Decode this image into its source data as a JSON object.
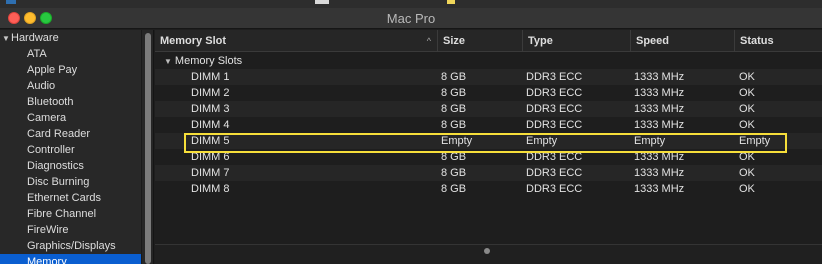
{
  "window": {
    "title": "Mac Pro"
  },
  "sidebar": {
    "groups": [
      {
        "label": "Hardware"
      }
    ],
    "items": [
      {
        "label": "ATA"
      },
      {
        "label": "Apple Pay"
      },
      {
        "label": "Audio"
      },
      {
        "label": "Bluetooth"
      },
      {
        "label": "Camera"
      },
      {
        "label": "Card Reader"
      },
      {
        "label": "Controller"
      },
      {
        "label": "Diagnostics"
      },
      {
        "label": "Disc Burning"
      },
      {
        "label": "Ethernet Cards"
      },
      {
        "label": "Fibre Channel"
      },
      {
        "label": "FireWire"
      },
      {
        "label": "Graphics/Displays"
      },
      {
        "label": "Memory",
        "selected": true
      }
    ]
  },
  "table": {
    "columns": [
      {
        "label": "Memory Slot",
        "sort_indicator": "^"
      },
      {
        "label": "Size"
      },
      {
        "label": "Type"
      },
      {
        "label": "Speed"
      },
      {
        "label": "Status"
      }
    ],
    "group_label": "Memory Slots",
    "rows": [
      {
        "slot": "DIMM 1",
        "size": "8 GB",
        "type": "DDR3 ECC",
        "speed": "1333 MHz",
        "status": "OK"
      },
      {
        "slot": "DIMM 2",
        "size": "8 GB",
        "type": "DDR3 ECC",
        "speed": "1333 MHz",
        "status": "OK"
      },
      {
        "slot": "DIMM 3",
        "size": "8 GB",
        "type": "DDR3 ECC",
        "speed": "1333 MHz",
        "status": "OK"
      },
      {
        "slot": "DIMM 4",
        "size": "8 GB",
        "type": "DDR3 ECC",
        "speed": "1333 MHz",
        "status": "OK"
      },
      {
        "slot": "DIMM 5",
        "size": "Empty",
        "type": "Empty",
        "speed": "Empty",
        "status": "Empty",
        "highlighted": true
      },
      {
        "slot": "DIMM 6",
        "size": "8 GB",
        "type": "DDR3 ECC",
        "speed": "1333 MHz",
        "status": "OK"
      },
      {
        "slot": "DIMM 7",
        "size": "8 GB",
        "type": "DDR3 ECC",
        "speed": "1333 MHz",
        "status": "OK"
      },
      {
        "slot": "DIMM 8",
        "size": "8 GB",
        "type": "DDR3 ECC",
        "speed": "1333 MHz",
        "status": "OK"
      }
    ]
  },
  "colors": {
    "selection": "#0a5ed0",
    "highlight_outline": "#f6de3a"
  },
  "icons": [
    "disclosure-triangle-icon",
    "sort-ascending-icon",
    "close-window-icon",
    "minimize-window-icon",
    "zoom-window-icon"
  ]
}
